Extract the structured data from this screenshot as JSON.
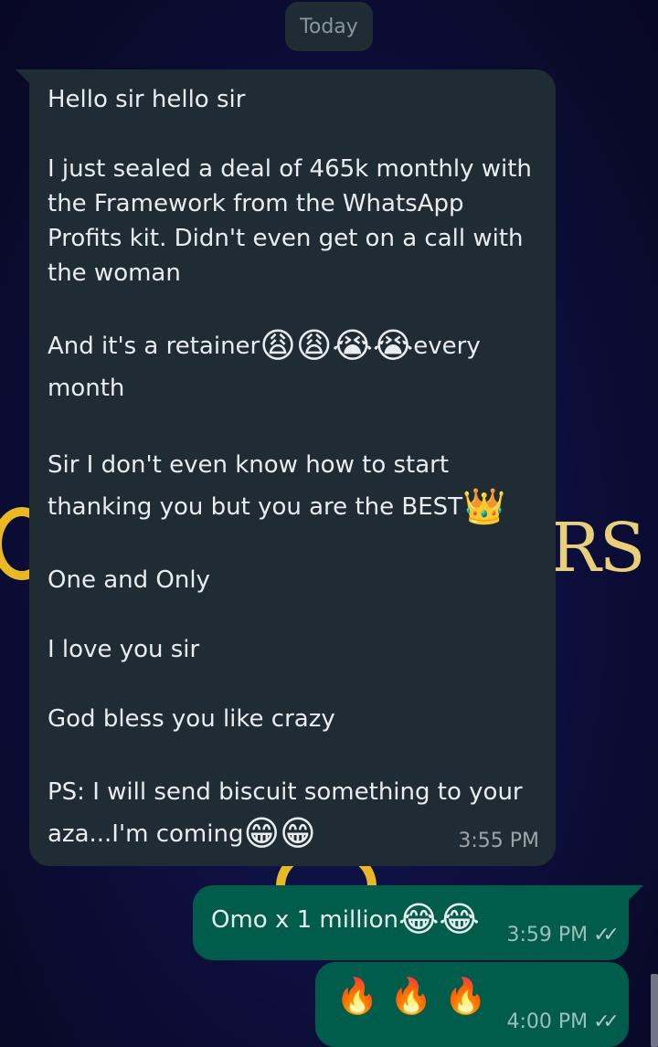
{
  "date_chip": "Today",
  "incoming_message": {
    "lines": {
      "l1": "Hello sir hello sir",
      "l2": "I just sealed a deal of 465k monthly with",
      "l3": "the Framework from the WhatsApp",
      "l4": "Profits kit. Didn't even get on a call with",
      "l5": "the woman",
      "l6a": "And it's a retainer",
      "l6_emoji": "😩😩😭😭",
      "l6b": "every",
      "l7": "month",
      "l8": "Sir I don't even know how to start",
      "l9a": "thanking you but you are the BEST",
      "l9_emoji": "👑",
      "l10": "One and Only",
      "l11": "I love you sir",
      "l12": "God bless you like crazy",
      "l13": "PS: I will send biscuit something to your",
      "l14a": "aza...I'm coming",
      "l14_emoji": "😁😁"
    },
    "time": "3:55 PM"
  },
  "outgoing_messages": [
    {
      "text": "Omo x 1 million",
      "emoji": "😂😂",
      "time": "3:59 PM",
      "status": "✓✓"
    },
    {
      "text": "",
      "emoji": "🔥 🔥 🔥",
      "time": "4:00 PM",
      "status": "✓✓"
    }
  ],
  "wallpaper": {
    "text_fragment": "RS"
  },
  "colors": {
    "background": "#0d0f3a",
    "incoming_bubble": "#202c33",
    "outgoing_bubble": "#005c4b",
    "text": "#e9edef",
    "meta_text": "#8696a0",
    "wallpaper_gold": "#e8b825"
  }
}
